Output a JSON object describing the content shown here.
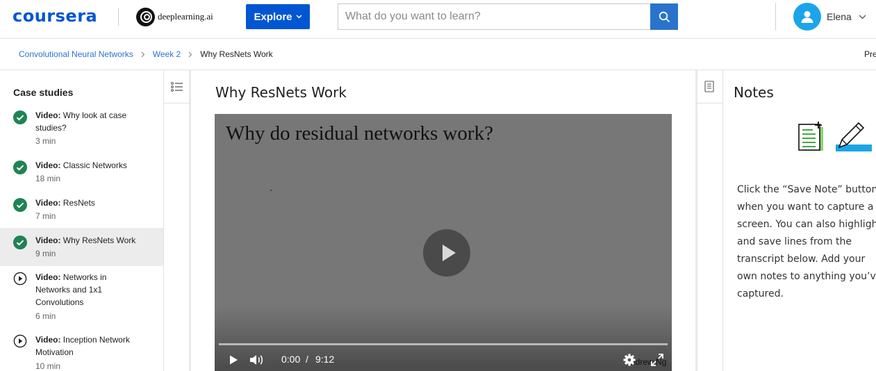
{
  "header": {
    "logo": "coursera",
    "partner": "deeplearning.ai",
    "explore_label": "Explore",
    "search_placeholder": "What do you want to learn?",
    "user_name": "Elena"
  },
  "breadcrumb": {
    "course": "Convolutional Neural Networks",
    "week": "Week 2",
    "current": "Why ResNets Work",
    "previous": "Pre"
  },
  "sidebar": {
    "section_title": "Case studies",
    "items": [
      {
        "type": "Video:",
        "title": "Why look at case studies?",
        "duration": "3 min",
        "status": "completed"
      },
      {
        "type": "Video:",
        "title": "Classic Networks",
        "duration": "18 min",
        "status": "completed"
      },
      {
        "type": "Video:",
        "title": "ResNets",
        "duration": "7 min",
        "status": "completed"
      },
      {
        "type": "Video:",
        "title": "Why ResNets Work",
        "duration": "9 min",
        "status": "completed"
      },
      {
        "type": "Video:",
        "title": "Networks in Networks and 1x1 Convolutions",
        "duration": "6 min",
        "status": "not-started"
      },
      {
        "type": "Video:",
        "title": "Inception Network Motivation",
        "duration": "10 min",
        "status": "not-started"
      }
    ]
  },
  "main": {
    "lesson_title": "Why ResNets Work",
    "video": {
      "slide_title": "Why do residual networks work?",
      "current_time": "0:00",
      "time_separator": "/",
      "duration": "9:12",
      "watermark": "Andrew Ng"
    }
  },
  "notes": {
    "title": "Notes",
    "help_text": "Click the “Save Note” button when you want to capture a screen. You can also highlight and save lines from the transcript below. Add your own notes to anything you’ve captured."
  },
  "colors": {
    "brand_blue": "#0056d2",
    "link_blue": "#2a73cc",
    "complete_green": "#1f8354",
    "avatar_blue": "#1ba5e8"
  }
}
